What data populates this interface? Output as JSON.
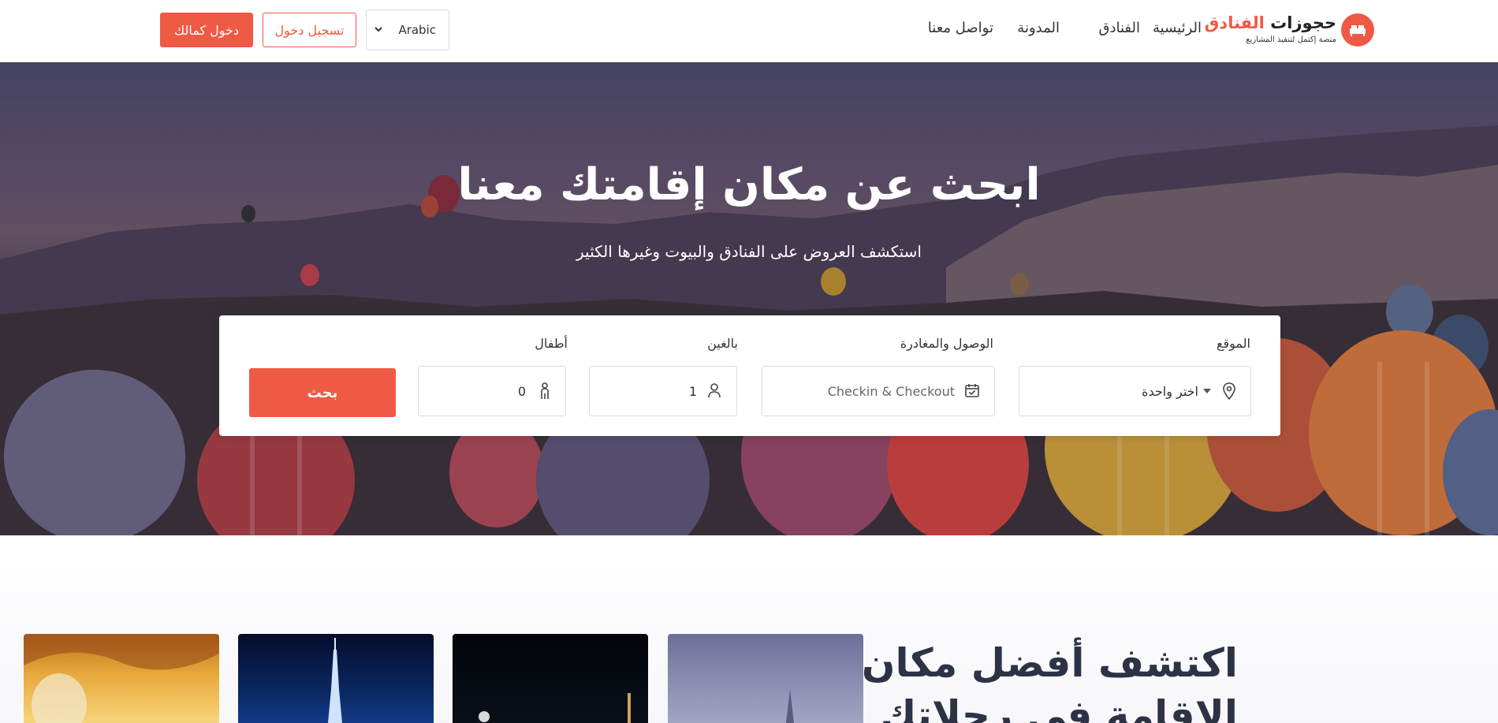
{
  "header": {
    "logo": {
      "title_main": "حجوزات",
      "title_accent": "الفنادق",
      "subtitle": "منصة إكتمل لتنفيذ المشاريع"
    },
    "nav": {
      "home": "الرئيسية",
      "hotels": "الفنادق",
      "blog": "المدونة",
      "contact": "تواصل معنا"
    },
    "language": "Arabic",
    "register_label": "تسجيل دخول",
    "login_label": "دخول كمالك"
  },
  "hero": {
    "title": "ابحث عن مكان إقامتك معنا",
    "subtitle": "استكشف العروض على الفنادق والبيوت وغيرها الكثير"
  },
  "search": {
    "location_label": "الموقع",
    "location_value": "اختر واحدة",
    "dates_label": "الوصول والمغادرة",
    "dates_placeholder": "Checkin & Checkout",
    "adults_label": "بالغين",
    "adults_value": "1",
    "children_label": "أطفال",
    "children_value": "0",
    "search_button": "بحث"
  },
  "section": {
    "title_line1": "اكتشف أفضل مكان",
    "title_line2": "الإقامة في رحلاتك"
  },
  "colors": {
    "accent": "#ef5a45",
    "text_dark": "#2c3345"
  },
  "icons": [
    "bed-icon",
    "chevron-down-icon",
    "map-pin-icon",
    "calendar-icon",
    "user-icon",
    "child-icon"
  ]
}
